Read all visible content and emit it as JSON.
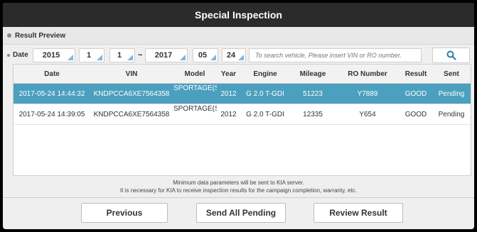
{
  "title": "Special Inspection",
  "result_preview": {
    "label": "Result Preview"
  },
  "date_filter": {
    "label": "Date",
    "from": {
      "year": "2015",
      "month": "1",
      "day": "1"
    },
    "separator": "~",
    "to": {
      "year": "2017",
      "month": "05",
      "day": "24"
    }
  },
  "search": {
    "placeholder": "To search vehicle, Please insert VIN or RO number.",
    "icon": "search-icon"
  },
  "table": {
    "columns": [
      "Date",
      "VIN",
      "Model",
      "Year",
      "Engine",
      "Mileage",
      "RO Number",
      "Result",
      "Sent"
    ],
    "rows": [
      {
        "date": "2017-05-24 14:44:32",
        "vin": "KNDPCCA6XE7564358",
        "model": "SPORTAGE(SL)",
        "year": "2012",
        "engine": "G 2.0 T-GDI",
        "mileage": "51223",
        "ro": "Y7889",
        "result": "GOOD",
        "sent": "Pending",
        "selected": true
      },
      {
        "date": "2017-05-24 14:39:05",
        "vin": "KNDPCCA6XE7564358",
        "model": "SPORTAGE(SL)",
        "year": "2012",
        "engine": "G 2.0 T-GDI",
        "mileage": "12335",
        "ro": "Y654",
        "result": "GOOD",
        "sent": "Pending",
        "selected": false
      }
    ]
  },
  "notice": {
    "line1": "Minimum data parameters will be sent to KIA server.",
    "line2": "It is necessary for KIA to receive inspection results for the campaign completion, warranty, etc."
  },
  "buttons": {
    "previous": "Previous",
    "send_all": "Send All Pending",
    "review": "Review Result"
  },
  "colors": {
    "selected_row": "#4b9fbf",
    "title_bar": "#2b2b2b",
    "search_icon": "#2a7fb0"
  }
}
